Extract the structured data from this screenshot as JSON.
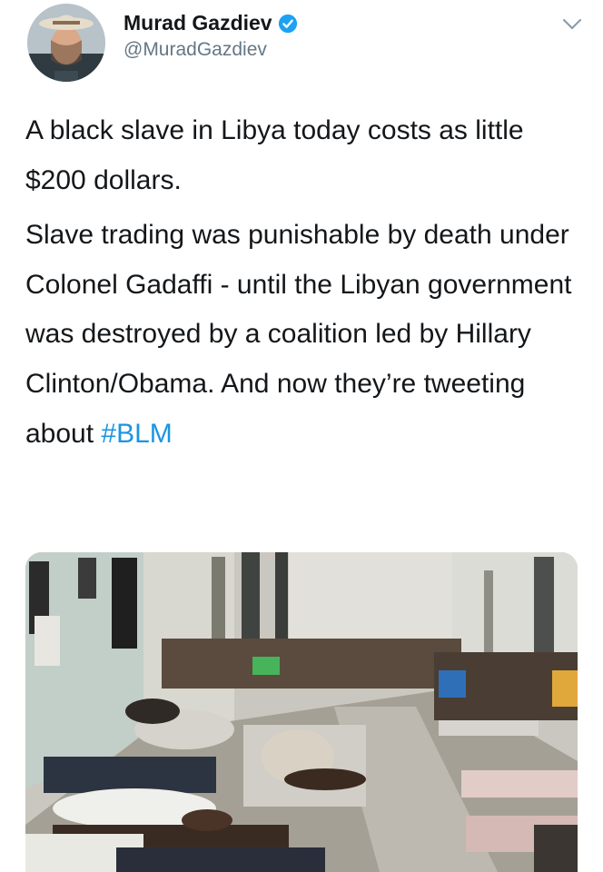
{
  "author": {
    "display_name": "Murad Gazdiev",
    "handle": "@MuradGazdiev",
    "verified": true
  },
  "tweet": {
    "paragraph_1": "A black slave in Libya today costs as little $200 dollars.",
    "paragraph_2_before_hashtag": "Slave trading was punishable by death  under Colonel Gadaffi - until the Libyan government was destroyed by a coalition led by Hillary Clinton/Obama. And now they’re tweeting about ",
    "hashtag": "#BLM"
  },
  "icons": {
    "verified": "verified-badge-icon",
    "more": "chevron-down-icon"
  },
  "colors": {
    "text": "#14171a",
    "secondary_text": "#657786",
    "link": "#1b95e0",
    "verified_badge": "#1da1f2"
  }
}
